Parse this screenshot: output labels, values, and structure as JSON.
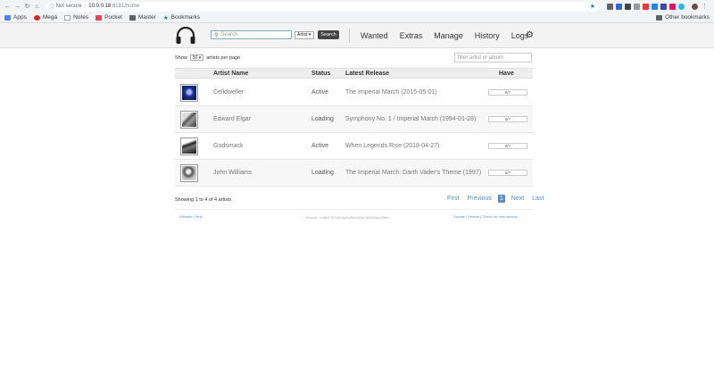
{
  "browser": {
    "security": "Not secure",
    "url_host": "10.0.0.18",
    "url_rest": ":8181/home"
  },
  "bookmarks": {
    "items": [
      {
        "label": "Apps",
        "color": "#4285f4"
      },
      {
        "label": "Mega",
        "color": "#d9272e"
      },
      {
        "label": "Notes",
        "color": "#9aa0a6"
      },
      {
        "label": "Pocket",
        "color": "#ef4056"
      },
      {
        "label": "Master",
        "color": "#5f6368"
      },
      {
        "label": "Bookmarks",
        "color": "#1a73e8"
      }
    ],
    "other": "Other bookmarks"
  },
  "header": {
    "search_placeholder": "Search",
    "search_type": "Artist",
    "search_button": "Search",
    "nav": [
      "Wanted",
      "Extras",
      "Manage",
      "History",
      "Logs"
    ]
  },
  "controls": {
    "show_prefix": "Show",
    "page_size": "50",
    "show_suffix": "artists per page",
    "filter_placeholder": "filter artist or album"
  },
  "table": {
    "columns": [
      "Artist Name",
      "Status",
      "Latest Release",
      "Have"
    ],
    "rows": [
      {
        "artist": "Celldweller",
        "status": "Active",
        "release": "The Imperial March (2015-05-01)",
        "have": "0/?",
        "art_color": "#1c2f8a"
      },
      {
        "artist": "Edward Elgar",
        "status": "Loading",
        "release": "Symphony No. 1 / Imperial March (1994-01-28)",
        "have": "0/?",
        "art_color": "#6b6b6b"
      },
      {
        "artist": "Godsmack",
        "status": "Active",
        "release": "When Legends Rise (2018-04-27)",
        "have": "0/?",
        "art_color": "#3a3a3a"
      },
      {
        "artist": "John Williams",
        "status": "Loading",
        "release": "The Imperial March: Darth Vader's Theme (1997)",
        "have": "0/?",
        "art_color": "#555555"
      }
    ]
  },
  "footer": {
    "showing": "Showing 1 to 4 of 4 artists",
    "pager": [
      "First",
      "Previous",
      "1",
      "Next",
      "Last"
    ],
    "left_links": "Website | Help",
    "version": "Version: cb4fd1767dc04a2b80e062cc1d9e2bbe2deb",
    "right_links": "Donate | Reboot | Check for new version"
  },
  "colors": {
    "accent": "#5a8dc8",
    "header_bg": "#f3f3f3"
  }
}
